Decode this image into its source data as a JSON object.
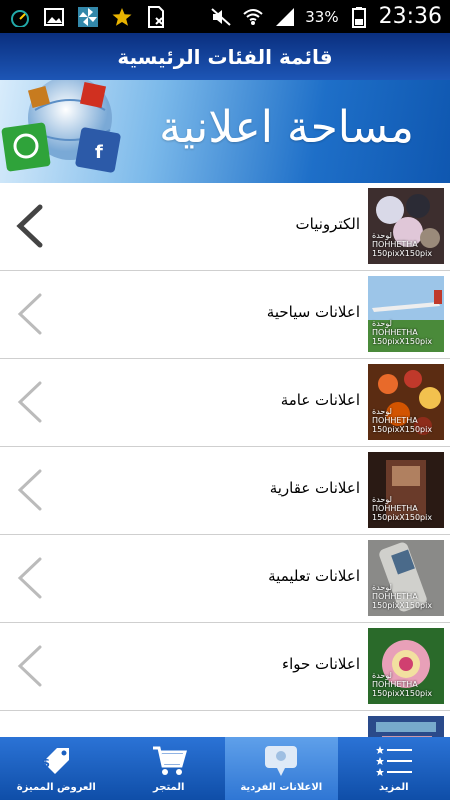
{
  "status_bar": {
    "battery": "33%",
    "time": "23:36",
    "icons": [
      "gauge-icon",
      "image-icon",
      "pinwheel-icon",
      "star-icon",
      "sim-card-icon",
      "mute-icon",
      "wifi-icon",
      "signal-icon",
      "battery-icon"
    ]
  },
  "header": {
    "title": "قائمة الفئات الرئيسية"
  },
  "banner": {
    "text": "مساحة اعلانية"
  },
  "thumb_watermark": {
    "brand": "لوحدة",
    "sub": "ПОННЕТНА",
    "size": "150pixX150pix"
  },
  "categories": [
    {
      "label": "الكترونيات"
    },
    {
      "label": "اعلانات سياحية"
    },
    {
      "label": "اعلانات عامة"
    },
    {
      "label": "اعلانات عقارية"
    },
    {
      "label": "اعلانات تعليمية"
    },
    {
      "label": "اعلانات حواء"
    }
  ],
  "bottom_nav": [
    {
      "label": "العروض المميزة",
      "icon": "price-tag-icon"
    },
    {
      "label": "المتجر",
      "icon": "cart-icon"
    },
    {
      "label": "الاعلانات الفردية",
      "icon": "chat-icon",
      "active": true
    },
    {
      "label": "المزيد",
      "icon": "menu-list-icon"
    }
  ]
}
